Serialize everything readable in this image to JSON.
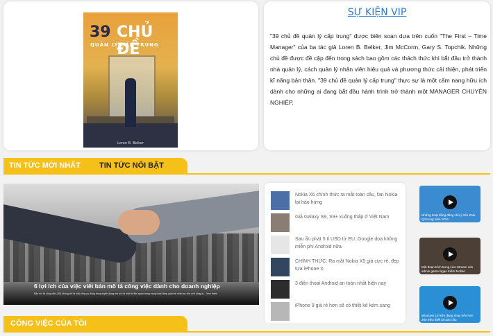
{
  "book": {
    "cover_title_number": "39",
    "cover_title_word": "CHỦ ĐỀ",
    "cover_subtitle": "QUẢN LÝ CẤP TRUNG",
    "cover_author": "Loren B. Belker"
  },
  "vip": {
    "title": "SỰ KIỆN VIP",
    "description": "\"39 chủ đề quản lý cấp trung\" được biên soạn dựa trên cuốn \"The First – Time Manager\" của ba tác giả Loren B. Belker, Jim McCorm, Gary S. Topchik. Những chủ đề được đề cập đến trong sách bao gồm các thách thức khi bắt đầu trở thành nhà quản lý, cách quản lý nhân viên hiệu quả và phương thức cải thiện, phát triển kĩ năng bản thân. \"39 chủ đề quản lý cấp trung\" thực sự là một cẩm nang hữu ích dành cho những ai đang bắt đầu hành trình trở thành một MANAGER CHUYÊN NGHIỆP."
  },
  "tabs": {
    "latest": "TIN TỨC MỚI NHẤT",
    "hot": "TIN TỨC NỔI BẬT"
  },
  "feature": {
    "title": "6 lợi ích của việc viết bản mô tả công việc dành cho doanh nghiệp",
    "desc": "Bản mô tả công việc (JD) không chỉ là một công cụ dùng trong tuyển dụng mà còn là một tài liệu quan trọng trong hoạt động quản trị nhân sự của mỗi công ty... Xem thêm"
  },
  "news": [
    {
      "text": "Nokia X6 chính thức ra mắt toàn cầu, fan Nokia lại háo hứng"
    },
    {
      "text": "Giá Galaxy S9, S9+ xuống thấp ở Việt Nam"
    },
    {
      "text": "Sau ấn phát 5 tỉ USD từ EU, Google dọa không miễn phí Android nữa"
    },
    {
      "text": "CHÍNH THỨC: Ra mắt Nokia X5 giá cực rẻ, đẹp tựa iPhone X"
    },
    {
      "text": "3 điện thoại Android an toàn nhất hiện nay"
    },
    {
      "text": "iPhone 9 giá rẻ hơn sẽ có thiết kế kém sang"
    }
  ],
  "videos": [
    {
      "caption": "Những hoạt động đáng chú ý trên Zalo Q4 trong năm 2016",
      "color": "#3b8bd0"
    },
    {
      "caption": "Một đoạn trích trong Live Stream của admin game Ngạo Kiếm Mobile",
      "color": "#4b3f36"
    },
    {
      "caption": "Windows 10 hiện đang chạy trên hơn 300 triệu thiết bị toàn cầu",
      "color": "#2b8fd6"
    }
  ],
  "jobs": {
    "label": "CÔNG VIỆC CỦA TÔI"
  }
}
